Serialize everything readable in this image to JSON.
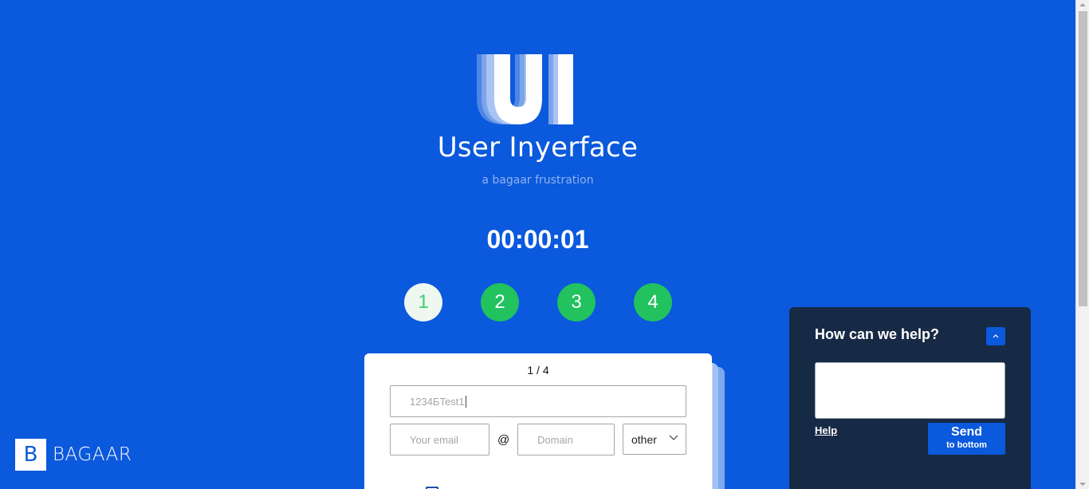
{
  "header": {
    "logo_icon": "ui-logo-icon",
    "title": "User Inyerface",
    "subtitle": "a bagaar frustration"
  },
  "timer": "00:00:01",
  "steps": [
    {
      "label": "1",
      "active": true
    },
    {
      "label": "2",
      "active": false
    },
    {
      "label": "3",
      "active": false
    },
    {
      "label": "4",
      "active": false
    }
  ],
  "form": {
    "page_indicator": "1 / 4",
    "password_value": "1234БTest1",
    "email_placeholder": "Your email",
    "at_symbol": "@",
    "domain_placeholder": "Domain",
    "tld_selected": "other"
  },
  "brand": {
    "letter": "B",
    "name": "BAGAAR"
  },
  "help_widget": {
    "title": "How can we help?",
    "help_link": "Help",
    "send_label": "Send",
    "send_sublabel": "to bottom"
  },
  "colors": {
    "background": "#0b59dc",
    "step_green": "#22c25f",
    "widget_bg": "#172a45"
  }
}
